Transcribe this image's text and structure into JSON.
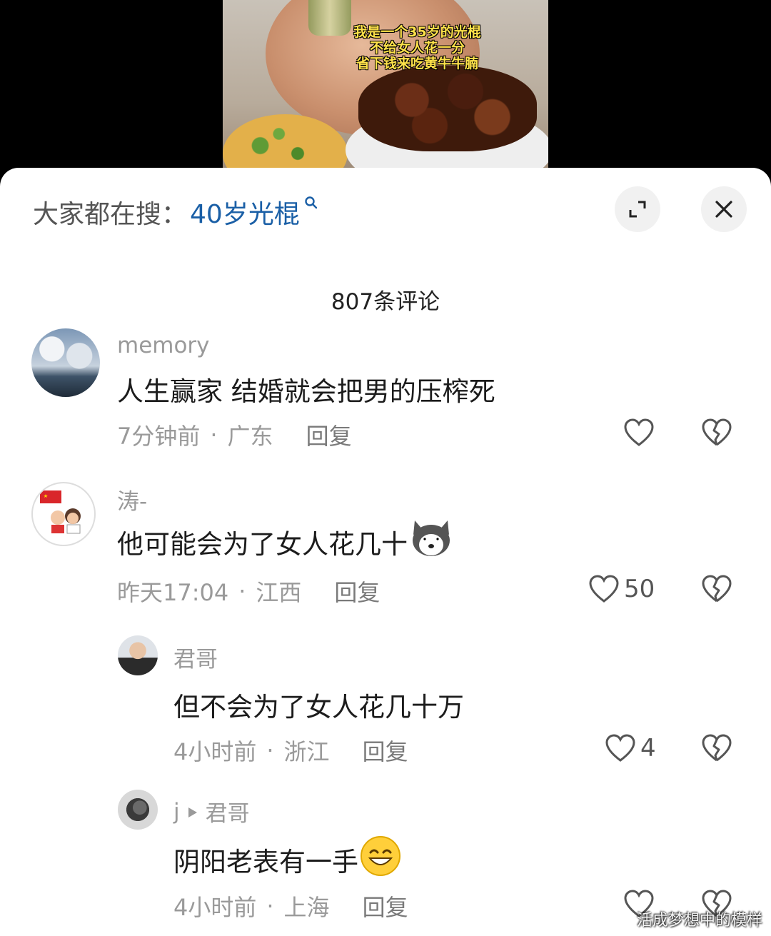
{
  "video": {
    "caption": [
      "我是一个35岁的光棍",
      "不给女人花一分",
      "省下钱来吃黄牛牛腩"
    ]
  },
  "header": {
    "search_prefix": "大家都在搜：",
    "search_keyword": "40岁光棍",
    "comment_count": "807条评论"
  },
  "comments": [
    {
      "name": "memory",
      "text": "人生赢家  结婚就会把男的压榨死",
      "time": "7分钟前",
      "location": "广东",
      "reply": "回复",
      "likes": ""
    },
    {
      "name": "涛-",
      "text": "他可能会为了女人花几十",
      "time": "昨天17:04",
      "location": "江西",
      "reply": "回复",
      "likes": "50"
    }
  ],
  "replies": [
    {
      "name": "君哥",
      "text": "但不会为了女人花几十万",
      "time": "4小时前",
      "location": "浙江",
      "reply": "回复",
      "likes": "4"
    },
    {
      "name": "j",
      "reply_to": "君哥",
      "text": "阴阳老表有一手",
      "time": "4小时前",
      "location": "上海",
      "reply": "回复",
      "likes": ""
    }
  ],
  "separator": "·",
  "watermark": "活成梦想中的模样",
  "colors": {
    "keyword": "#1a5fa6",
    "caption": "#ffe24a"
  }
}
